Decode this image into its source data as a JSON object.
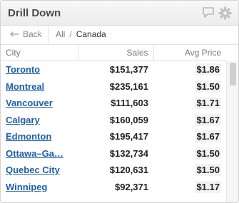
{
  "widget": {
    "title": "Drill Down",
    "icons": [
      "comment-icon",
      "gear-icon"
    ]
  },
  "nav": {
    "back_label": "Back",
    "breadcrumb_root": "All",
    "breadcrumb_sep": "/",
    "breadcrumb_current": "Canada"
  },
  "table": {
    "columns": [
      "City",
      "Sales",
      "Avg Price"
    ],
    "rows": [
      {
        "city": "Toronto",
        "sales": "$151,377",
        "price": "$1.86"
      },
      {
        "city": "Montreal",
        "sales": "$235,161",
        "price": "$1.50"
      },
      {
        "city": "Vancouver",
        "sales": "$111,603",
        "price": "$1.71"
      },
      {
        "city": "Calgary",
        "sales": "$160,059",
        "price": "$1.67"
      },
      {
        "city": "Edmonton",
        "sales": "$195,417",
        "price": "$1.67"
      },
      {
        "city": "Ottawa–Ga…",
        "sales": "$132,734",
        "price": "$1.50"
      },
      {
        "city": "Quebec City",
        "sales": "$120,631",
        "price": "$1.50"
      },
      {
        "city": "Winnipeg",
        "sales": "$92,371",
        "price": "$1.17"
      }
    ]
  },
  "colors": {
    "link": "#1f5fa8",
    "header_text": "#4a4a4a"
  }
}
